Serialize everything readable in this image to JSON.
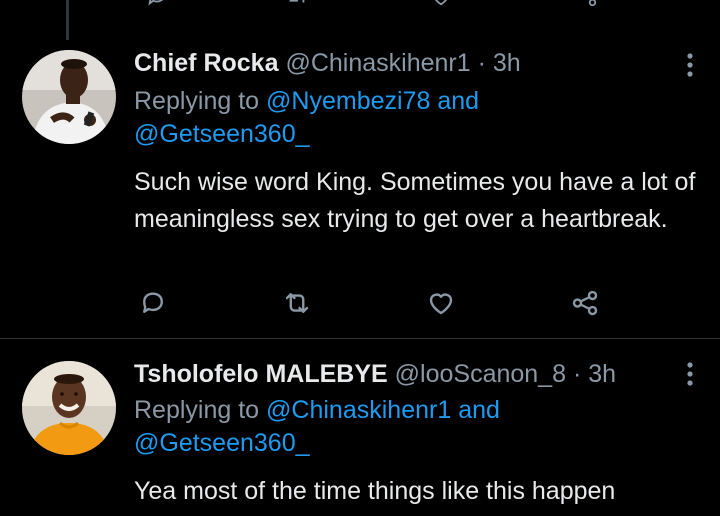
{
  "colors": {
    "background": "#000000",
    "text_primary": "#e7e9ea",
    "text_secondary": "#8b98a5",
    "link": "#1d9bf0",
    "divider": "#2f3336"
  },
  "tweets": [
    {
      "display_name": "Chief Rocka",
      "handle": "@Chinaskihenr1",
      "separator": "·",
      "time": "3h",
      "replying_prefix": "Replying to",
      "reply_to_1": "@Nyembezi78",
      "reply_joiner": "and",
      "reply_to_2": "@Getseen360_",
      "text": "Such wise word King. Sometimes you have a lot of meaningless sex trying to get over a heartbreak.",
      "avatar": "avatar-photo-man-white-shirt",
      "action_icons": [
        "reply-icon",
        "retweet-icon",
        "like-icon",
        "share-icon"
      ]
    },
    {
      "display_name": "Tsholofelo MALEBYE",
      "handle": "@looScanon_8",
      "separator": "·",
      "time": "3h",
      "replying_prefix": "Replying to",
      "reply_to_1": "@Chinaskihenr1",
      "reply_joiner": "and",
      "reply_to_2": "@Getseen360_",
      "text": "Yea most of the time things like this happen",
      "avatar": "avatar-photo-man-orange-top"
    }
  ]
}
